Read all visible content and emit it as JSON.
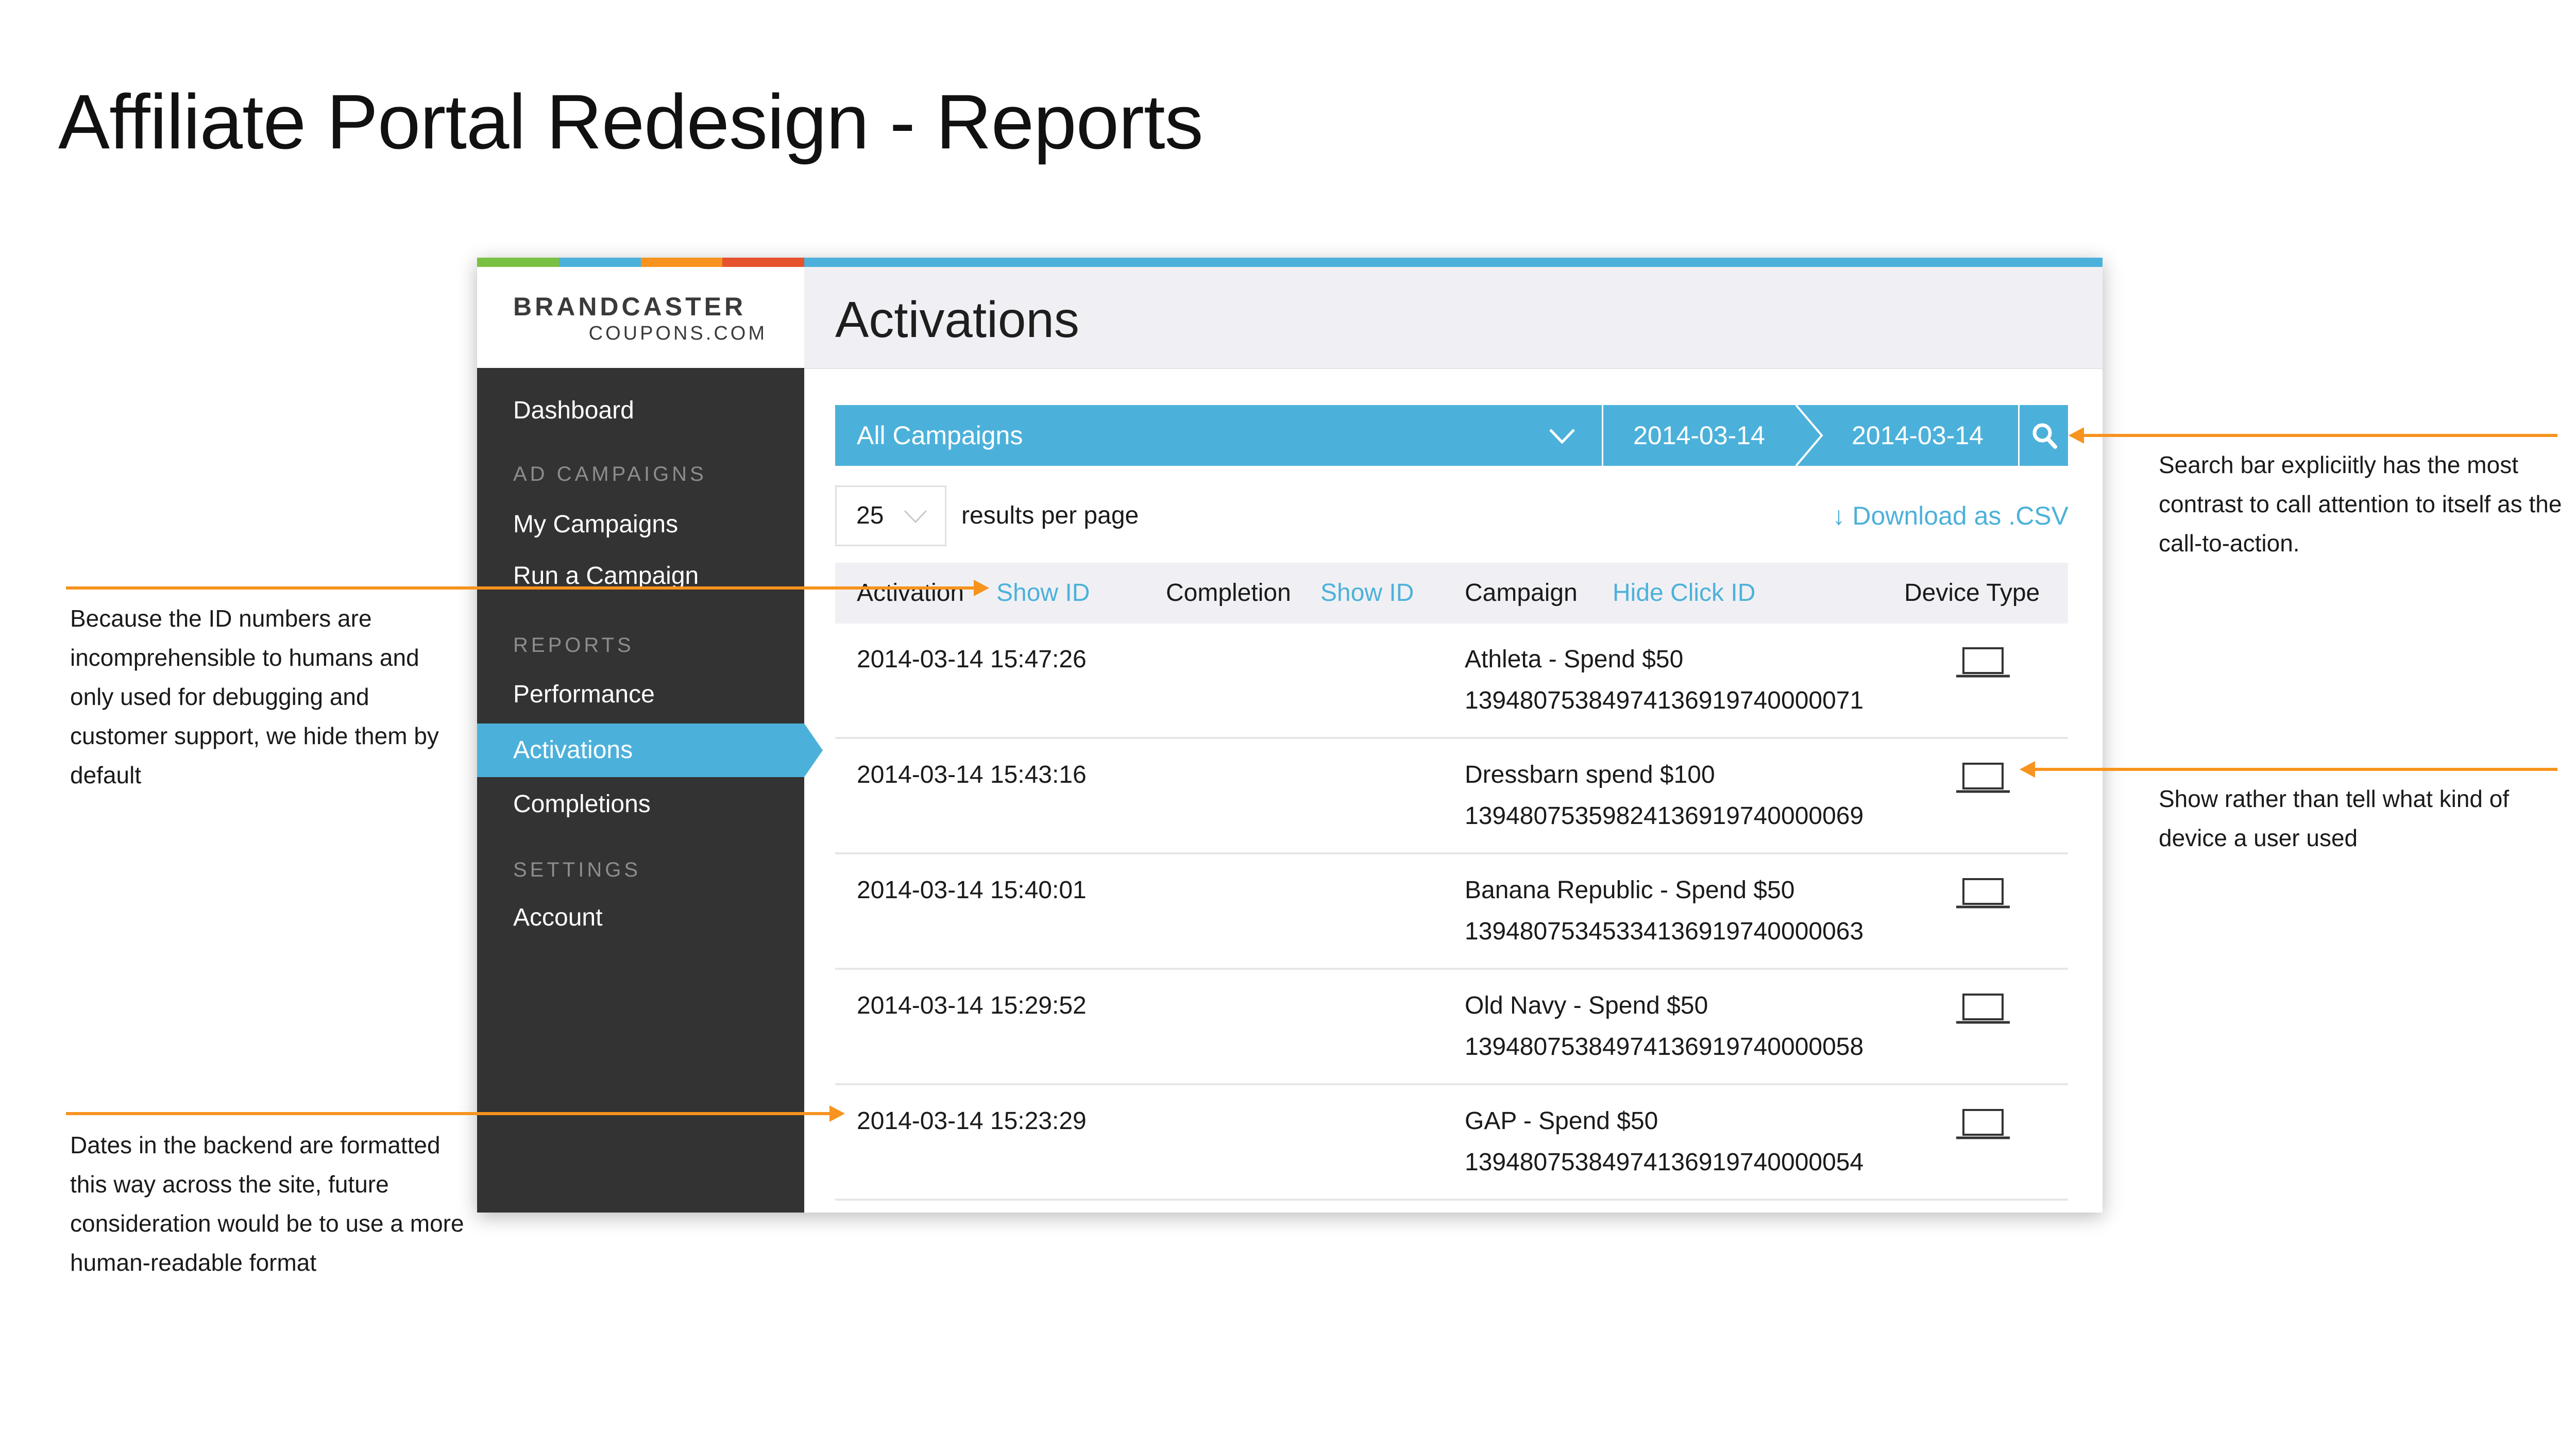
{
  "slide_title": "Affiliate Portal Redesign - Reports",
  "brand": {
    "name": "BRANDCASTER",
    "sub": "COUPONS.COM",
    "stripe_colors": [
      "#7ac143",
      "#4cb1da",
      "#f7931e",
      "#e5532d"
    ]
  },
  "sidebar": {
    "dashboard": "Dashboard",
    "section_ad_campaigns": "AD CAMPAIGNS",
    "my_campaigns": "My Campaigns",
    "run_campaign": "Run a Campaign",
    "section_reports": "REPORTS",
    "performance": "Performance",
    "activations": "Activations",
    "completions": "Completions",
    "section_settings": "SETTINGS",
    "account": "Account"
  },
  "page_title": "Activations",
  "filter": {
    "campaign": "All Campaigns",
    "date_from": "2014-03-14",
    "date_to": "2014-03-14"
  },
  "per_page": {
    "value": "25",
    "label": "results per page"
  },
  "download_label": "↓ Download as .CSV",
  "table": {
    "headers": {
      "activation": "Activation",
      "activation_toggle": "Show ID",
      "completion": "Completion",
      "completion_toggle": "Show ID",
      "campaign": "Campaign",
      "campaign_toggle": "Hide Click ID",
      "device": "Device Type"
    },
    "rows": [
      {
        "time": "2014-03-14 15:47:26",
        "campaign": "Athleta - Spend $50",
        "click_id": "13948075384974136919740000071",
        "device": "laptop-icon"
      },
      {
        "time": "2014-03-14 15:43:16",
        "campaign": "Dressbarn spend $100",
        "click_id": "13948075359824136919740000069",
        "device": "laptop-icon"
      },
      {
        "time": "2014-03-14 15:40:01",
        "campaign": "Banana Republic - Spend $50",
        "click_id": "13948075345334136919740000063",
        "device": "laptop-icon"
      },
      {
        "time": "2014-03-14 15:29:52",
        "campaign": "Old Navy - Spend $50",
        "click_id": "13948075384974136919740000058",
        "device": "laptop-icon"
      },
      {
        "time": "2014-03-14 15:23:29",
        "campaign": "GAP - Spend $50",
        "click_id": "13948075384974136919740000054",
        "device": "laptop-icon"
      }
    ]
  },
  "annotations": {
    "id_hidden": "Because the ID numbers are incomprehensible to humans and only used for debugging and customer support, we hide them by default",
    "date_format": "Dates in the backend are formatted this way across the site, future consideration would be to use a more human-readable format",
    "search_bar": "Search bar expliciitly has the most contrast to call attention to itself as the call-to-action.",
    "device": "Show rather than tell what kind of device a user used"
  },
  "colors": {
    "accent": "#4cb1da",
    "sidebar": "#333333",
    "annotation_line": "#f7931e"
  }
}
